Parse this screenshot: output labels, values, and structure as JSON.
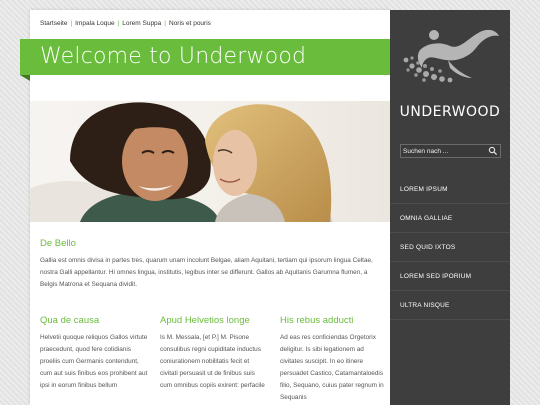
{
  "breadcrumb": {
    "items": [
      "Startseite",
      "Impala Loque",
      "Lorem Suppa",
      "Noris et pouris"
    ]
  },
  "banner": {
    "title": "Welcome to Underwood"
  },
  "intro": {
    "heading": "De Bello",
    "text": "Gallia est omnis divisa in partes tres, quarum unam incolunt Belgae, aliam Aquitani, tertiam qui ipsorum lingua Celtae, nostra Galli appellantur. Hi omnes lingua, institutis, legibus inter se differunt. Gallos ab Aquitanis Garumna flumen, a Belgis Matrona et Sequana dividit."
  },
  "columns": [
    {
      "heading": "Qua de causa",
      "text": "Helvetii quoque reliquos Gallos virtute praecedunt, quod fere cotidianis proeliis cum Germanis contendunt, cum aut suis finibus eos prohibent aut ipsi in eorum finibus bellum"
    },
    {
      "heading": "Apud Helvetios longe",
      "text": "Is M. Messala, [et P.] M. Pisone consulibus regni cupiditate inductus coniurationem nobilitatis fecit et civitati persuasit ut de finibus suis cum omnibus copiis exirent: perfacile"
    },
    {
      "heading": "His rebus adducti",
      "text": "Ad eas res conficiendas Orgetorix deligitur. Is sibi legationem ad civitates suscipit. In eo itinere persuadet Castico, Catamantaloedis filio, Sequano, cuius pater regnum in Sequanis"
    }
  ],
  "sidebar": {
    "logo_text": "UNDERWOOD",
    "search_placeholder": "Suchen nach ...",
    "nav": [
      "LOREM IPSUM",
      "OMNIA GALLIAE",
      "SED QUID IXTOS",
      "LOREM SED IPORIUM",
      "ULTRA NISQUE"
    ]
  },
  "colors": {
    "accent": "#6abd3c",
    "sidebar": "#3e3e3e",
    "background": "#e6e6e6"
  }
}
